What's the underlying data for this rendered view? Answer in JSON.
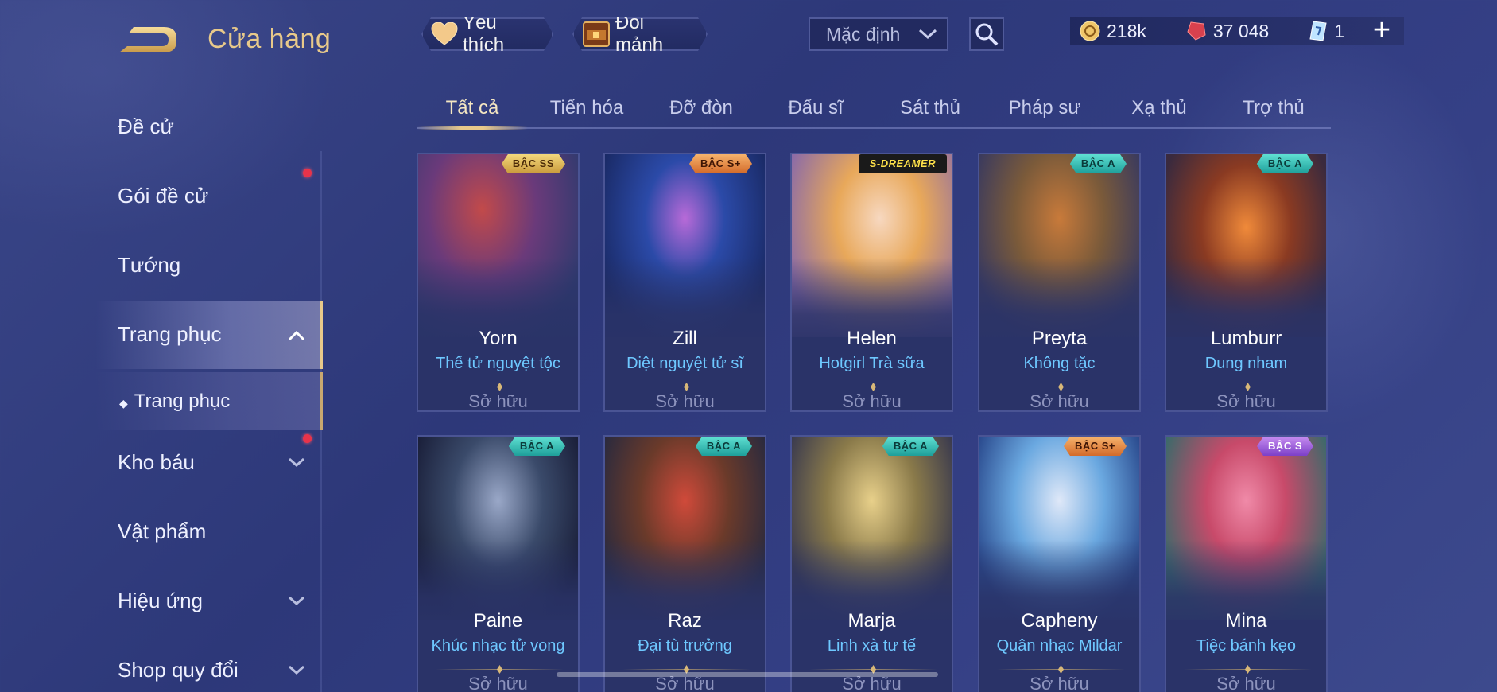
{
  "header": {
    "title": "Cửa hàng",
    "favorites_label": "Yêu thích",
    "exchange_label": "Đổi mảnh",
    "sort_value": "Mặc định"
  },
  "currency": {
    "gold": "218k",
    "quan_huy": "37 048",
    "voucher": "1"
  },
  "sidebar": {
    "items": [
      {
        "label": "Đề cử"
      },
      {
        "label": "Gói đề cử"
      },
      {
        "label": "Tướng"
      },
      {
        "label": "Trang phục"
      },
      {
        "label": "Trang phục"
      },
      {
        "label": "Kho báu"
      },
      {
        "label": "Vật phẩm"
      },
      {
        "label": "Hiệu ứng"
      },
      {
        "label": "Shop quy đổi"
      }
    ]
  },
  "tabs": [
    "Tất cả",
    "Tiến hóa",
    "Đỡ đòn",
    "Đấu sĩ",
    "Sát thủ",
    "Pháp sư",
    "Xạ thủ",
    "Trợ thủ"
  ],
  "cards": [
    {
      "hero": "Yorn",
      "skin": "Thế tử nguyệt tộc",
      "status": "Sở hữu",
      "badge": "BẬC SS"
    },
    {
      "hero": "Zill",
      "skin": "Diệt nguyệt tử sĩ",
      "status": "Sở hữu",
      "badge": "BẬC S+"
    },
    {
      "hero": "Helen",
      "skin": "Hotgirl Trà sữa",
      "status": "Sở hữu",
      "badge": "S-DREAMER"
    },
    {
      "hero": "Preyta",
      "skin": "Không tặc",
      "status": "Sở hữu",
      "badge": "BẬC A"
    },
    {
      "hero": "Lumburr",
      "skin": "Dung nham",
      "status": "Sở hữu",
      "badge": "BẬC A"
    },
    {
      "hero": "Paine",
      "skin": "Khúc nhạc tử vong",
      "status": "Sở hữu",
      "badge": "BẬC A"
    },
    {
      "hero": "Raz",
      "skin": "Đại tù trưởng",
      "status": "Sở hữu",
      "badge": "BẬC A"
    },
    {
      "hero": "Marja",
      "skin": "Linh xà tư tế",
      "status": "Sở hữu",
      "badge": "BẬC A"
    },
    {
      "hero": "Capheny",
      "skin": "Quân nhạc Mildar",
      "status": "Sở hữu",
      "badge": "BẬC S+"
    },
    {
      "hero": "Mina",
      "skin": "Tiệc bánh kẹo",
      "status": "Sở hữu",
      "badge": "BẬC S"
    }
  ],
  "colors": {
    "accent_gold": "#e8c98a",
    "skin_name_blue": "#6ec8ff",
    "badge_a": "#1e9f9a",
    "badge_s": "#7c3fc8",
    "badge_splus": "#d36a2a",
    "badge_ss": "#c99a3c"
  },
  "icons": {
    "back": "back-arrow-icon",
    "favorites": "heart-icon",
    "exchange": "chest-icon",
    "search": "search-icon",
    "gold": "gold-coin-icon",
    "quan_huy": "red-gem-icon",
    "voucher": "voucher-icon",
    "add": "plus-icon"
  }
}
